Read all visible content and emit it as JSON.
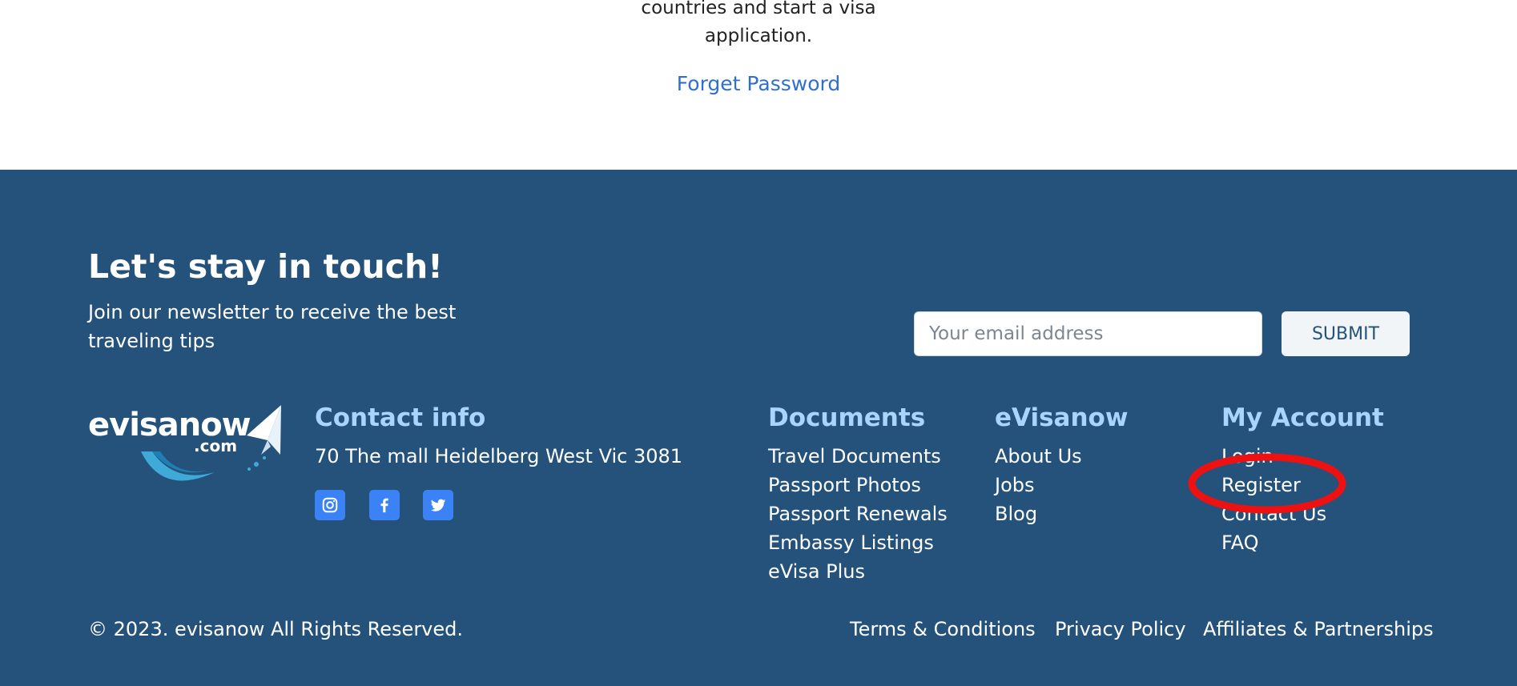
{
  "top": {
    "text_line1": "countries and start a visa",
    "text_line2": "application.",
    "forget_password": "Forget Password"
  },
  "newsletter": {
    "title": "Let's stay in touch!",
    "subtitle": "Join our newsletter to receive the best traveling tips",
    "email_placeholder": "Your email address",
    "submit_label": "SUBMIT"
  },
  "logo": {
    "text": "evisanow",
    "suffix": ".com",
    "icon": "paper-plane-icon"
  },
  "contact": {
    "title": "Contact info",
    "address": "70 The mall Heidelberg West Vic 3081",
    "socials": [
      "instagram-icon",
      "facebook-icon",
      "twitter-icon"
    ]
  },
  "documents": {
    "title": "Documents",
    "links": [
      "Travel Documents",
      "Passport Photos",
      "Passport Renewals",
      "Embassy Listings",
      "eVisa Plus"
    ]
  },
  "evisanow": {
    "title": "eVisanow",
    "links": [
      "About Us",
      "Jobs",
      "Blog"
    ]
  },
  "account": {
    "title": "My Account",
    "links": [
      "Login",
      "Register",
      "Contact Us",
      "FAQ"
    ]
  },
  "bottom": {
    "copyright": "© 2023. evisanow All Rights Reserved.",
    "terms": "Terms & Conditions",
    "privacy": "Privacy Policy",
    "affiliates": "Affiliates & Partnerships"
  },
  "colors": {
    "footer_bg": "#25527a",
    "link_blue": "#2f6fd1",
    "heading_light_blue": "#a9d4fb",
    "social_blue": "#3b82f6",
    "annotation_red": "#ee1111"
  }
}
